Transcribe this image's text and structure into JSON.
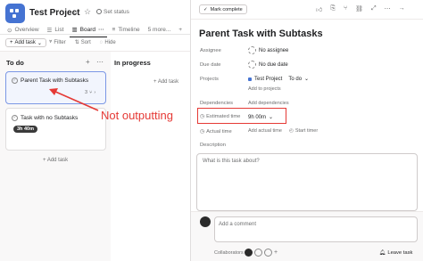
{
  "project": {
    "title": "Test Project",
    "chevron_icon": "chevron-down-icon",
    "star_icon": "star-icon",
    "status_label": "Set status"
  },
  "tabs": [
    {
      "label": "Overview",
      "icon": "overview-icon",
      "active": false
    },
    {
      "label": "List",
      "icon": "list-icon",
      "active": false
    },
    {
      "label": "Board",
      "icon": "board-icon",
      "active": true
    },
    {
      "label": "Timeline",
      "icon": "timeline-icon",
      "active": false
    },
    {
      "label": "5 more...",
      "icon": "",
      "active": false
    }
  ],
  "board_toolbar": {
    "add_task": "Add task",
    "filter": "Filter",
    "sort": "Sort",
    "hide": "Hide"
  },
  "columns": {
    "todo": {
      "title": "To do",
      "cards": [
        {
          "title": "Parent Task with Subtasks",
          "subtasks": "3",
          "selected": true
        },
        {
          "title": "Task with no Subtasks",
          "time": "3h 40m",
          "selected": false
        }
      ],
      "add_task": "+ Add task"
    },
    "in_progress": {
      "title": "In progress",
      "add_task": "+ Add task"
    }
  },
  "annotation": {
    "text": "Not outputting",
    "color": "#e53935"
  },
  "detail": {
    "mark_complete": "Mark complete",
    "toolbar_icons": [
      "thumbs-up-icon",
      "attachment-icon",
      "subtask-icon",
      "link-icon",
      "expand-icon",
      "more-icon",
      "close-icon"
    ],
    "title": "Parent Task with Subtasks",
    "assignee_label": "Assignee",
    "assignee_value": "No assignee",
    "due_label": "Due date",
    "due_value": "No due date",
    "projects_label": "Projects",
    "project_name": "Test Project",
    "project_section": "To do",
    "add_to_projects": "Add to projects",
    "dependencies_label": "Dependencies",
    "add_dependencies": "Add dependencies",
    "estimated_label": "Estimated time",
    "estimated_value": "9h 00m",
    "actual_label": "Actual time",
    "add_actual": "Add actual time",
    "start_timer": "Start timer",
    "description_label": "Description",
    "description_placeholder": "What is this task about?",
    "comment_placeholder": "Add a comment",
    "collaborators_label": "Collaborators",
    "leave_task": "Leave task"
  },
  "colors": {
    "brand": "#4573d2",
    "selected_border": "#7b97e5",
    "annotation": "#e53935"
  }
}
